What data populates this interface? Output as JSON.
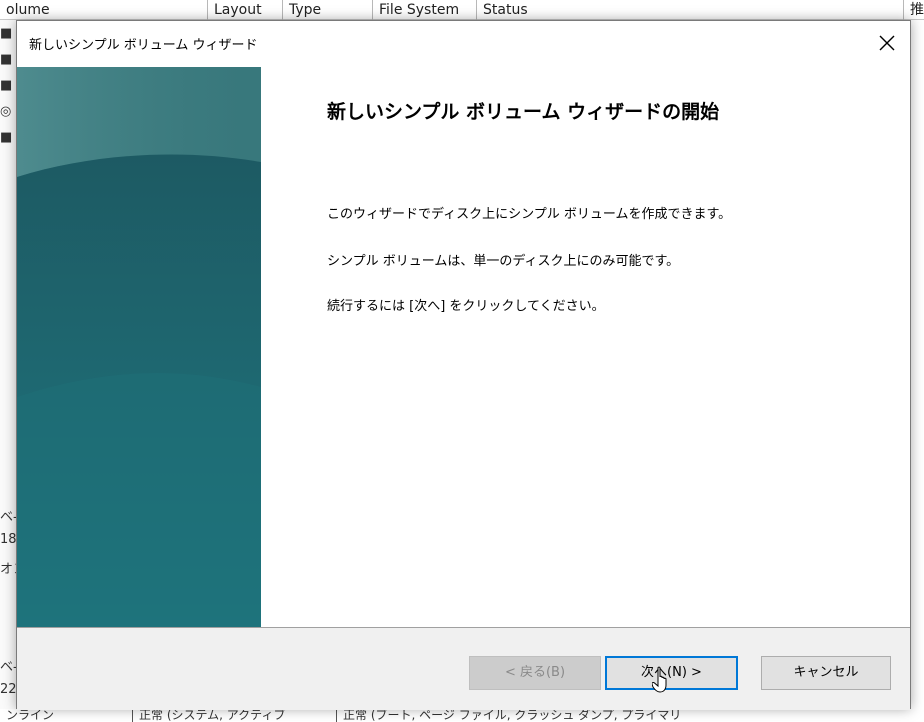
{
  "background": {
    "columns": [
      "olume",
      "Layout",
      "Type",
      "File System",
      "Status",
      "推"
    ],
    "left_fragments": [
      "■",
      "■ (",
      "■ S",
      "◎ l",
      "■ :",
      "ベ-",
      "18",
      "オン",
      "ベ-",
      "22"
    ],
    "bottom_cells": [
      "ンライン",
      "正常 (システム, アクティブ",
      "正常 (ブート, ページ ファイル, クラッシュ ダンプ, プライマリ"
    ]
  },
  "dialog": {
    "title": "新しいシンプル ボリューム ウィザード",
    "heading": "新しいシンプル ボリューム ウィザードの開始",
    "body": {
      "line1": "このウィザードでディスク上にシンプル ボリュームを作成できます。",
      "line2": "シンプル ボリュームは、単一のディスク上にのみ可能です。",
      "line3": "続行するには [次へ] をクリックしてください。"
    },
    "buttons": {
      "back": "< 戻る(B)",
      "next": "次へ(N) >",
      "cancel": "キャンセル"
    }
  },
  "icons": {
    "close": "close-icon",
    "cursor": "mouse-cursor-icon"
  },
  "colors": {
    "banner_top": "#3e7d80",
    "banner_bottom": "#1f6a73",
    "accent": "#0078d7"
  }
}
